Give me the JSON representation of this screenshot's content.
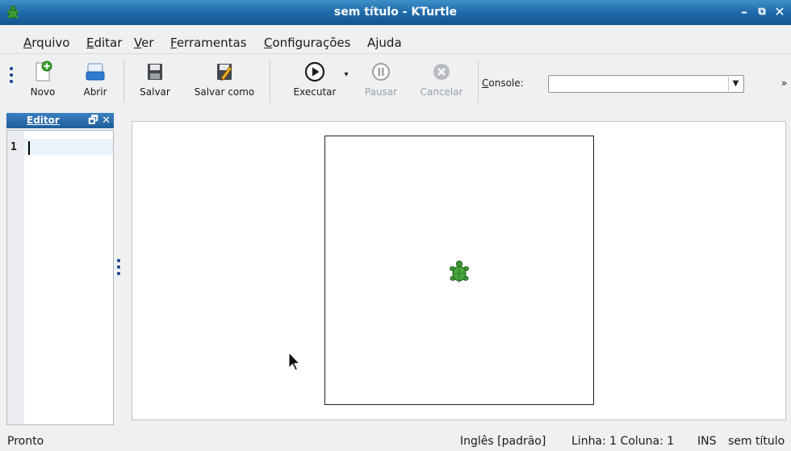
{
  "window": {
    "title": "sem título - KTurtle",
    "controls": [
      "minimize-icon",
      "maximize-icon",
      "close-icon"
    ]
  },
  "menu": [
    {
      "accel": "A",
      "rest": "rquivo"
    },
    {
      "accel": "E",
      "rest": "ditar",
      "pre": ""
    },
    {
      "accel": "V",
      "rest": "er"
    },
    {
      "accel": "F",
      "rest": "erramentas"
    },
    {
      "accel": "C",
      "rest": "onfigurações"
    },
    {
      "accel": "",
      "rest": "Ajuda"
    }
  ],
  "menu_display": {
    "m0a": "A",
    "m0b": "rquivo",
    "m1a": "E",
    "m1b": "ditar",
    "m2a": "V",
    "m2b": "er",
    "m3a": "F",
    "m3b": "erramentas",
    "m4a": "C",
    "m4b": "onfigurações",
    "m5b": "Ajuda"
  },
  "toolbar": {
    "new_label": "Novo",
    "open_label": "Abrir",
    "save_label": "Salvar",
    "save_as_label": "Salvar como",
    "run_label": "Executar",
    "pause_label": "Pausar",
    "cancel_label": "Cancelar",
    "console_label_pre": "C",
    "console_label_rest": "onsole:",
    "console_value": "",
    "more": "»"
  },
  "editor": {
    "dock_title": "Editor",
    "line_number": "1",
    "content": ""
  },
  "status": {
    "left": "Pronto",
    "language": "Inglês [padrão]",
    "position": "Linha: 1 Coluna: 1",
    "mode": "INS",
    "file": "sem título"
  },
  "colors": {
    "titlebar": "#1e6aab",
    "turtle_green": "#3f9a35"
  }
}
